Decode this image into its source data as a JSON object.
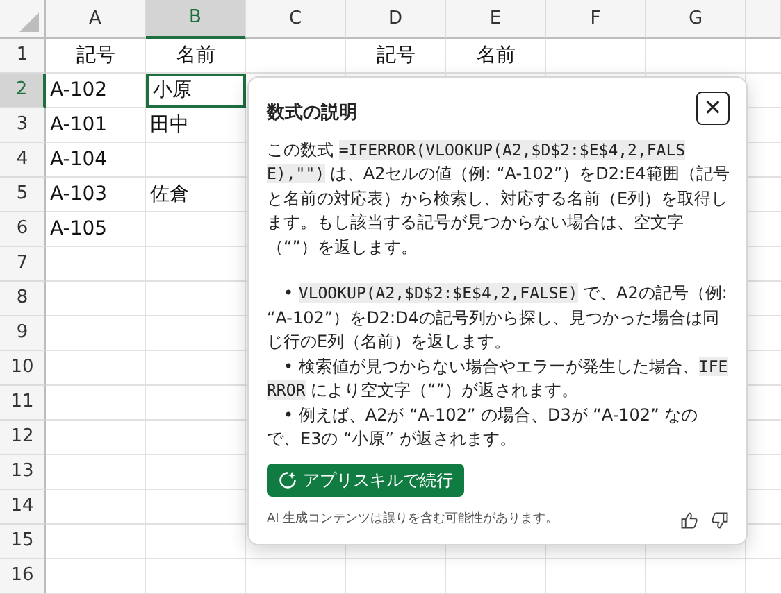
{
  "sheet": {
    "columns": [
      {
        "label": "A",
        "selected": false
      },
      {
        "label": "B",
        "selected": true
      },
      {
        "label": "C",
        "selected": false
      },
      {
        "label": "D",
        "selected": false
      },
      {
        "label": "E",
        "selected": false
      },
      {
        "label": "F",
        "selected": false
      },
      {
        "label": "G",
        "selected": false
      }
    ],
    "rows": [
      {
        "label": "1",
        "selected": false,
        "cells": {
          "A": "記号",
          "B": "名前",
          "D": "記号",
          "E": "名前"
        },
        "centered": true
      },
      {
        "label": "2",
        "selected": true,
        "cells": {
          "A": "A-102",
          "B": "小原"
        }
      },
      {
        "label": "3",
        "selected": false,
        "cells": {
          "A": "A-101",
          "B": "田中"
        }
      },
      {
        "label": "4",
        "selected": false,
        "cells": {
          "A": "A-104"
        }
      },
      {
        "label": "5",
        "selected": false,
        "cells": {
          "A": "A-103",
          "B": "佐倉"
        }
      },
      {
        "label": "6",
        "selected": false,
        "cells": {
          "A": "A-105"
        }
      },
      {
        "label": "7",
        "selected": false,
        "cells": {}
      },
      {
        "label": "8",
        "selected": false,
        "cells": {}
      },
      {
        "label": "9",
        "selected": false,
        "cells": {}
      },
      {
        "label": "10",
        "selected": false,
        "cells": {}
      },
      {
        "label": "11",
        "selected": false,
        "cells": {}
      },
      {
        "label": "12",
        "selected": false,
        "cells": {}
      },
      {
        "label": "13",
        "selected": false,
        "cells": {}
      },
      {
        "label": "14",
        "selected": false,
        "cells": {}
      },
      {
        "label": "15",
        "selected": false,
        "cells": {}
      },
      {
        "label": "16",
        "selected": false,
        "cells": {}
      }
    ]
  },
  "popup": {
    "title": "数式の説明",
    "close": "✕",
    "paragraphs": [
      {
        "kind": "plain",
        "segments": [
          {
            "kind": "text",
            "text": "この数式 "
          },
          {
            "kind": "code",
            "text": "=IFERROR(VLOOKUP(A2,$D$2:$E$4,2,FALSE),\"\")"
          },
          {
            "kind": "text",
            "text": " は、A2セルの値（例: “A-102”）をD2:E4範囲（記号と名前の対応表）から検索し、対応する名前（E列）を取得します。もし該当する記号が見つからない場合は、空文字（“”）を返します。"
          }
        ]
      },
      {
        "kind": "bullet",
        "segments": [
          {
            "kind": "text",
            "text": "• "
          },
          {
            "kind": "code",
            "text": "VLOOKUP(A2,$D$2:$E$4,2,FALSE)"
          },
          {
            "kind": "text",
            "text": " で、A2の記号（例: “A-102”）をD2:D4の記号列から探し、見つかった場合は同じ行のE列（名前）を返します。"
          }
        ]
      },
      {
        "kind": "bullet",
        "segments": [
          {
            "kind": "text",
            "text": "• 検索値が見つからない場合やエラーが発生した場合、"
          },
          {
            "kind": "code",
            "text": "IFERROR"
          },
          {
            "kind": "text",
            "text": " により空文字（“”）が返されます。"
          }
        ]
      },
      {
        "kind": "bullet",
        "segments": [
          {
            "kind": "text",
            "text": "• 例えば、A2が “A-102” の場合、D3が “A-102” なので、E3の “小原” が返されます。"
          }
        ]
      }
    ],
    "action": "アプリスキルで続行",
    "disclaimer": "AI 生成コンテンツは誤りを含む可能性があります。"
  }
}
